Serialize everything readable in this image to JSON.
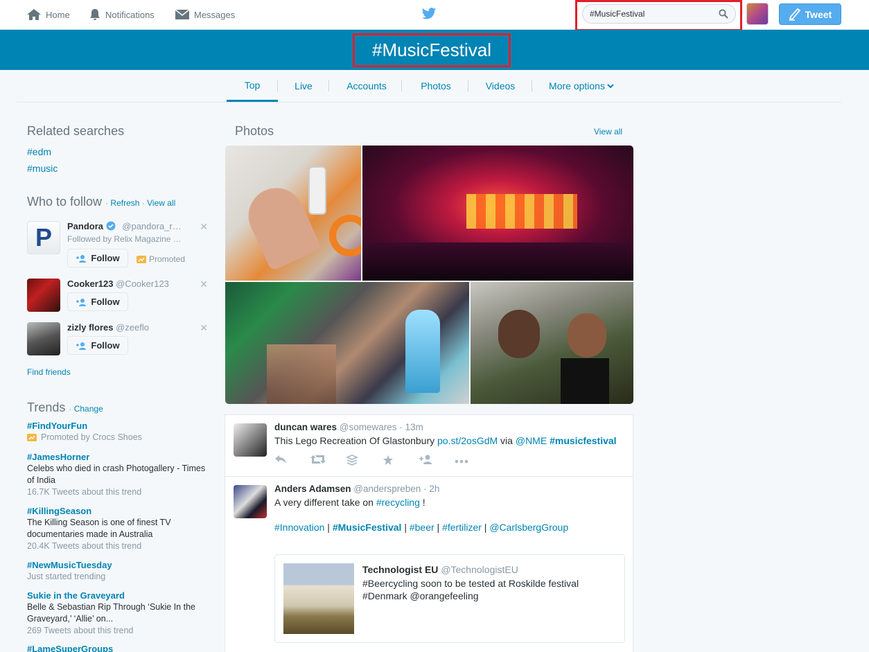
{
  "topnav": {
    "home_label": "Home",
    "notifications_label": "Notifications",
    "messages_label": "Messages",
    "search_value": "#MusicFestival",
    "tweet_button_label": "Tweet"
  },
  "banner": {
    "title": "#MusicFestival"
  },
  "tabs": {
    "top": "Top",
    "live": "Live",
    "accounts": "Accounts",
    "photos": "Photos",
    "videos": "Videos",
    "more": "More options"
  },
  "related": {
    "heading": "Related searches",
    "items": [
      "#edm",
      "#music"
    ]
  },
  "who_to_follow": {
    "heading": "Who to follow",
    "refresh": "Refresh",
    "view_all": "View all",
    "accounts": [
      {
        "name": "Pandora",
        "handle": "@pandora_r…",
        "followed_by_label": "Followed by",
        "followed_by": "Relix Magazine …",
        "promoted": "Promoted",
        "follow_label": "Follow"
      },
      {
        "name": "Cooker123",
        "handle": "@Cooker123",
        "follow_label": "Follow"
      },
      {
        "name": "zizly flores",
        "handle": "@zeeflo",
        "follow_label": "Follow"
      }
    ],
    "find_friends": "Find friends"
  },
  "trends": {
    "heading": "Trends",
    "change": "Change",
    "items": [
      {
        "tag": "#FindYourFun",
        "meta": "Promoted by Crocs Shoes"
      },
      {
        "tag": "#JamesHorner",
        "desc": "Celebs who died in crash Photogallery - Times of India",
        "meta": "16.7K Tweets about this trend"
      },
      {
        "tag": "#KillingSeason",
        "desc": "The Killing Season is one of finest TV documentaries made in Australia",
        "meta": "20.4K Tweets about this trend"
      },
      {
        "tag": "#NewMusicTuesday",
        "meta": "Just started trending"
      },
      {
        "tag": "Sukie in the Graveyard",
        "desc": "Belle & Sebastian Rip Through ‘Sukie In the Graveyard,’ ‘Allie’ on...",
        "meta": "269 Tweets about this trend"
      },
      {
        "tag": "#LameSuperGroups"
      }
    ]
  },
  "photos": {
    "heading": "Photos",
    "view_all": "View all"
  },
  "tweets": [
    {
      "name": "duncan wares",
      "handle": "@somewares",
      "time": "· 13m",
      "text_pre": "This Lego Recreation Of Glastonbury ",
      "link": "po.st/2osGdM",
      "text_mid": " via ",
      "mention": "@NME",
      "hashtag": "#musicfestival"
    },
    {
      "name": "Anders Adamsen",
      "handle": "@anderspreben",
      "time": "· 2h",
      "text_pre": "A very different take on ",
      "hashtag1": "#recycling",
      "text_post": " !",
      "tags": [
        "#Innovation",
        "#MusicFestival",
        "#beer",
        "#fertilizer",
        "@CarlsbergGroup"
      ],
      "sep": " | ",
      "quote": {
        "name": "Technologist EU",
        "handle": "@TechnologistEU",
        "line1": "#Beercycling soon to be tested at Roskilde festival",
        "line2": "#Denmark @orangefeeling"
      }
    }
  ],
  "colors": {
    "brand": "#0084b4",
    "tweet_button": "#55acee",
    "highlight": "#e0202c"
  }
}
